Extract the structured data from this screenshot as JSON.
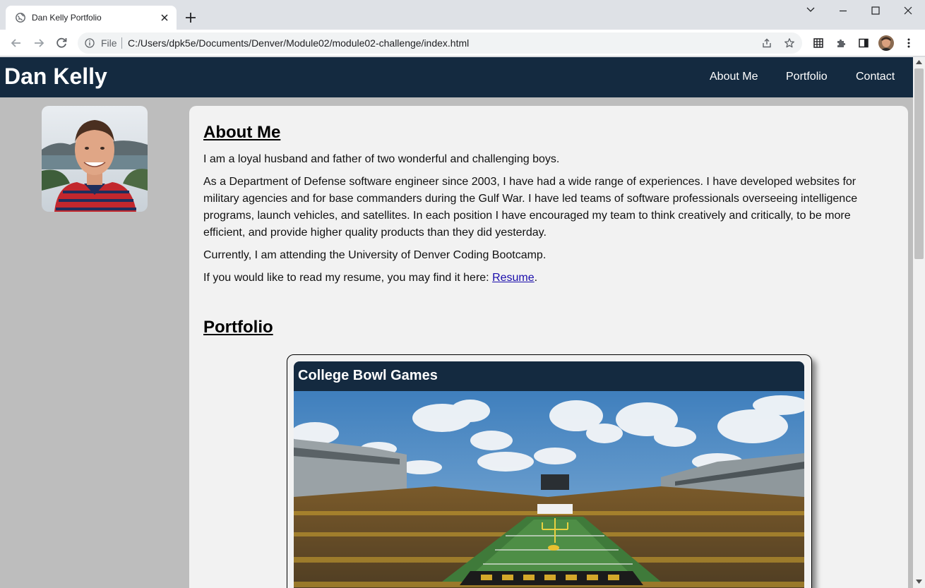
{
  "browser": {
    "tab_title": "Dan Kelly Portfolio",
    "omnibox": {
      "scheme_label": "File",
      "url": "C:/Users/dpk5e/Documents/Denver/Module02/module02-challenge/index.html"
    },
    "icons": {
      "tab_favicon": "globe-icon",
      "tab_close": "close-icon",
      "new_tab": "plus-icon",
      "tab_search": "chevron-down-icon",
      "minimize": "minimize-icon",
      "maximize": "maximize-icon",
      "close_window": "close-icon",
      "back": "back-arrow-icon",
      "forward": "forward-arrow-icon",
      "reload": "reload-icon",
      "site_info": "info-icon",
      "share": "share-icon",
      "bookmark": "star-icon",
      "qr": "grid-icon",
      "extensions": "puzzle-icon",
      "side_panel": "side-panel-icon",
      "profile": "profile-avatar",
      "menu": "kebab-menu-icon"
    }
  },
  "site": {
    "title": "Dan Kelly",
    "nav": [
      "About Me",
      "Portfolio",
      "Contact"
    ],
    "colors": {
      "header": "#142a40",
      "page_bg": "#bdbdbd",
      "card_bg": "#f2f2f2",
      "link": "#1a0dab"
    }
  },
  "about": {
    "heading": "About Me",
    "p1": "I am a loyal husband and father of two wonderful and challenging boys.",
    "p2": "As a Department of Defense software engineer since 2003, I have had a wide range of experiences. I have developed websites for military agencies and for base commanders during the Gulf War. I have led teams of software professionals overseeing intelligence programs, launch vehicles, and satellites. In each position I have encouraged my team to think creatively and critically, to be more efficient, and provide higher quality products than they did yesterday.",
    "p3": "Currently, I am attending the University of Denver Coding Bootcamp.",
    "p4_prefix": "If you would like to read my resume, you may find it here: ",
    "resume_link": "Resume",
    "p4_suffix": "."
  },
  "portfolio": {
    "heading": "Portfolio",
    "projects": [
      {
        "title": "College Bowl Games"
      }
    ]
  }
}
